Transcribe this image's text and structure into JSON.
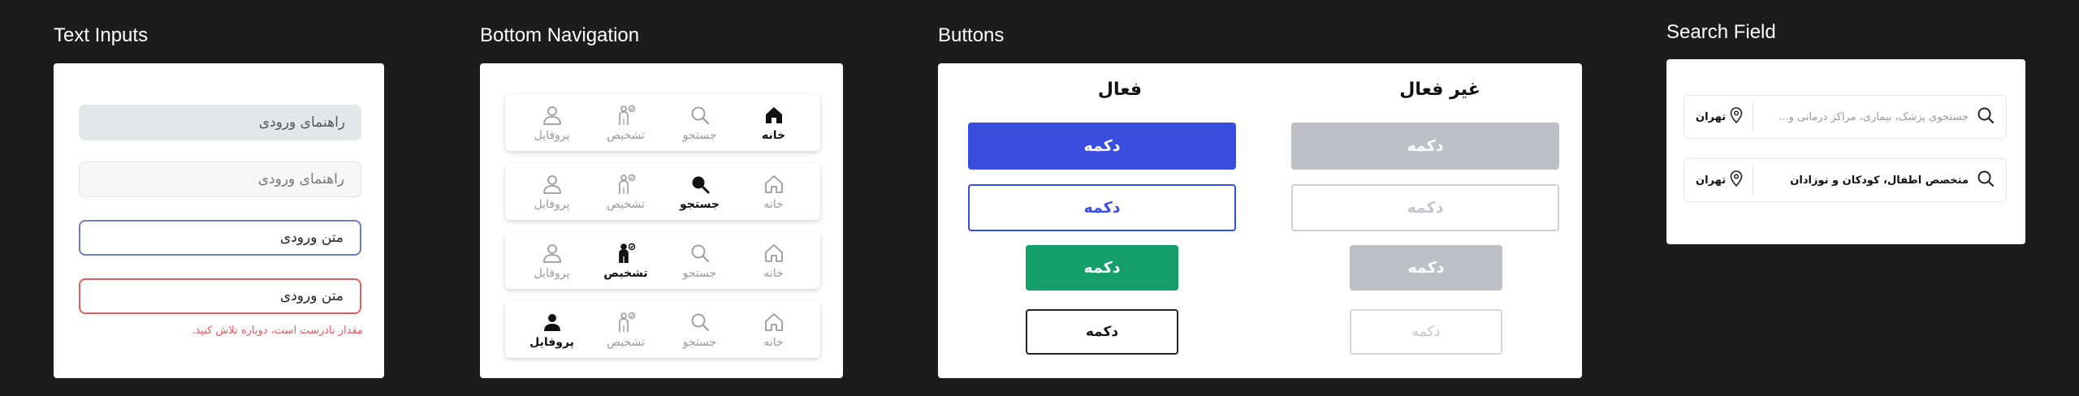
{
  "sections": {
    "text_inputs": "Text Inputs",
    "bottom_navigation": "Bottom Navigation",
    "buttons": "Buttons",
    "search_field": "Search Field"
  },
  "text_inputs": {
    "placeholder_filled": "راهنمای ورودی",
    "placeholder_outline": "راهنمای ورودی",
    "value_focus": "متن ورودی",
    "value_error": "متن ورودی",
    "error_message": "مقدار نادرست است، دوباره تلاش کنید."
  },
  "bottom_nav": {
    "labels": {
      "home": "خانه",
      "search": "جستجو",
      "diagnosis": "تشخیص",
      "profile": "پروفایل"
    },
    "bars": [
      {
        "active": "home"
      },
      {
        "active": "search"
      },
      {
        "active": "diagnosis"
      },
      {
        "active": "profile"
      }
    ]
  },
  "buttons": {
    "active_header": "فعال",
    "inactive_header": "غیر فعال",
    "label": "دکمه",
    "colors": {
      "primary": "#3a4ddf",
      "success": "#149e6a",
      "disabled": "#bfc0c6"
    }
  },
  "search": {
    "placeholder": "جستجوی پزشک، بیماری، مراکز درمانی و...",
    "query": "متخصص اطفال، کودکان و نوزادان",
    "city": "تهران"
  }
}
